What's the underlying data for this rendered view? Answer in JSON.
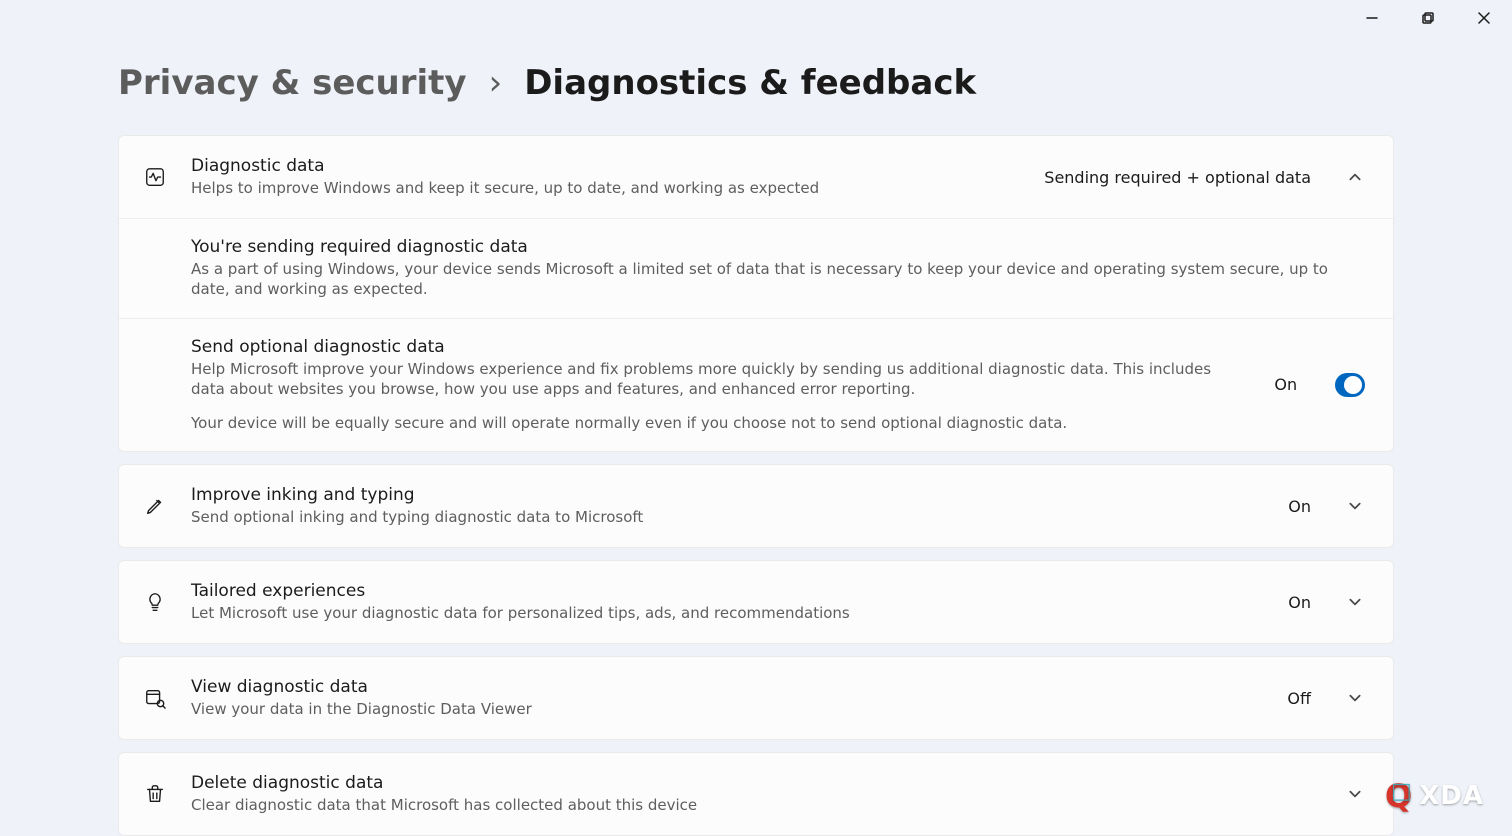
{
  "breadcrumb": {
    "parent": "Privacy & security",
    "separator": "›",
    "current": "Diagnostics & feedback"
  },
  "diagnostic": {
    "title": "Diagnostic data",
    "subtitle": "Helps to improve Windows and keep it secure, up to date, and working as expected",
    "status": "Sending required + optional data",
    "required": {
      "title": "You're sending required diagnostic data",
      "body": "As a part of using Windows, your device sends Microsoft a limited set of data that is necessary to keep your device and operating system secure, up to date, and working as expected."
    },
    "optional": {
      "title": "Send optional diagnostic data",
      "body": "Help Microsoft improve your Windows experience and fix problems more quickly by sending us additional diagnostic data. This includes data about websites you browse, how you use apps and features, and enhanced error reporting.",
      "footer": "Your device will be equally secure and will operate normally even if you choose not to send optional diagnostic data.",
      "toggle_label": "On",
      "toggle_on": true
    }
  },
  "inking": {
    "title": "Improve inking and typing",
    "subtitle": "Send optional inking and typing diagnostic data to Microsoft",
    "status": "On"
  },
  "tailored": {
    "title": "Tailored experiences",
    "subtitle": "Let Microsoft use your diagnostic data for personalized tips, ads, and recommendations",
    "status": "On"
  },
  "view": {
    "title": "View diagnostic data",
    "subtitle": "View your data in the Diagnostic Data Viewer",
    "status": "Off"
  },
  "delete": {
    "title": "Delete diagnostic data",
    "subtitle": "Clear diagnostic data that Microsoft has collected about this device"
  },
  "watermark": {
    "text": "XDA"
  }
}
